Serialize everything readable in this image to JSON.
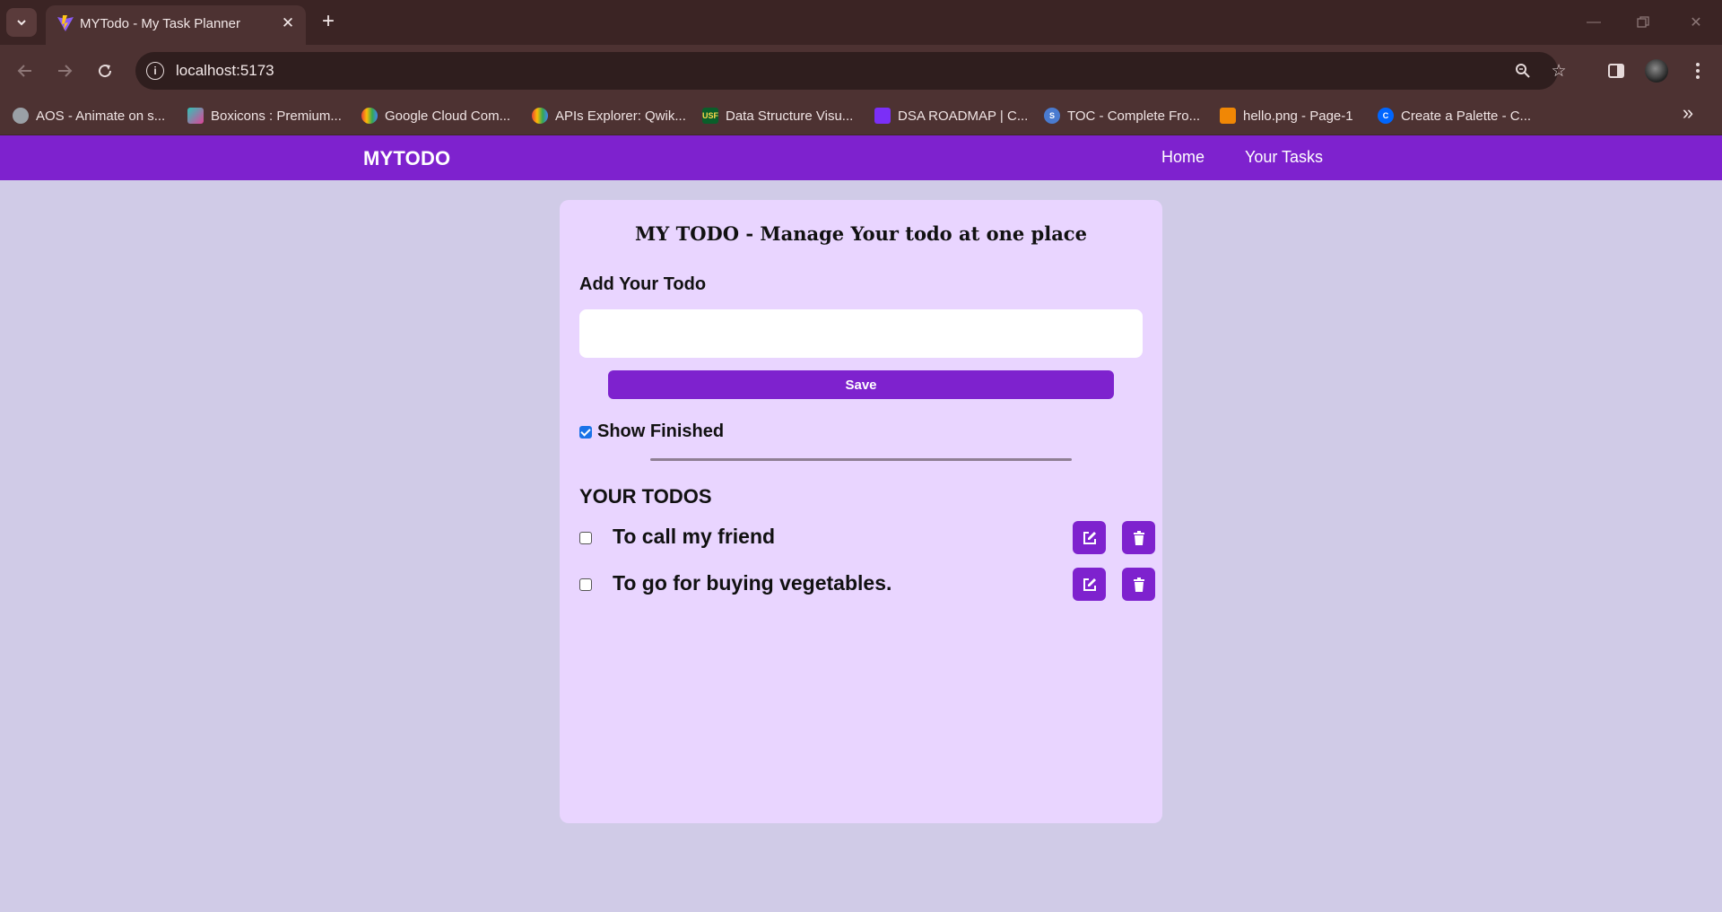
{
  "browser": {
    "tab": {
      "title": "MYTodo - My Task Planner"
    },
    "address": {
      "url": "localhost:5173"
    },
    "bookmarks": [
      {
        "label": "AOS - Animate on s...",
        "icon": "globe-icon",
        "color": "#9aa0a6"
      },
      {
        "label": "Boxicons : Premium...",
        "icon": "boxicons-icon",
        "color": "#2ec4b6"
      },
      {
        "label": "Google Cloud Com...",
        "icon": "google-cloud-icon",
        "color": "#4285f4"
      },
      {
        "label": "APIs Explorer: Qwik...",
        "icon": "google-cloud-icon",
        "color": "#4285f4"
      },
      {
        "label": "Data Structure Visu...",
        "icon": "usf-icon",
        "color": "#0a5e2a"
      },
      {
        "label": "DSA ROADMAP | C...",
        "icon": "monitor-icon",
        "color": "#7b2ff7"
      },
      {
        "label": "TOC - Complete Fro...",
        "icon": "toc-icon",
        "color": "#4a7bd0"
      },
      {
        "label": "hello.png - Page-1",
        "icon": "drawio-icon",
        "color": "#f08705"
      },
      {
        "label": "Create a Palette - C...",
        "icon": "coolors-icon",
        "color": "#0066ff"
      }
    ]
  },
  "app": {
    "brand": "MYTODO",
    "nav": {
      "home": "Home",
      "tasks": "Your Tasks"
    },
    "card": {
      "title": "MY TODO - Manage Your todo at one place",
      "add_label": "Add Your Todo",
      "input_value": "",
      "save_label": "Save",
      "show_finished_label": "Show Finished",
      "show_finished_checked": true,
      "todos_title": "YOUR TODOS",
      "todos": [
        {
          "text": "To call my friend",
          "done": false
        },
        {
          "text": "To go for buying vegetables.",
          "done": false
        }
      ]
    },
    "colors": {
      "accent": "#7e22ce",
      "card_bg": "#e9d5ff",
      "page_bg": "#d0cbe7"
    }
  }
}
